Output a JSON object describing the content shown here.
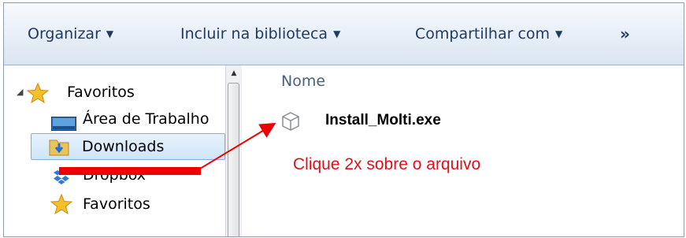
{
  "toolbar": {
    "organize_label": "Organizar",
    "library_label": "Incluir na biblioteca",
    "share_label": "Compartilhar com",
    "more_label": "»"
  },
  "nav": {
    "items": [
      {
        "label": "Favoritos",
        "icon": "star-icon"
      },
      {
        "label": "Área de Trabalho",
        "icon": "desktop-icon"
      },
      {
        "label": "Downloads",
        "icon": "downloads-folder-icon",
        "selected": true
      },
      {
        "label": "Dropbox",
        "icon": "dropbox-icon"
      },
      {
        "label": "Favoritos",
        "icon": "star-icon"
      }
    ]
  },
  "content": {
    "column_header": "Nome",
    "files": [
      {
        "name": "Install_Molti.exe",
        "icon": "exe-file-icon"
      }
    ]
  },
  "annotation": {
    "text": "Clique 2x sobre o arquivo",
    "color": "#e0101a"
  },
  "colors": {
    "toolbar_text": "#1e3a5f",
    "selection_border": "#84acdd",
    "annotation_red": "#ee0000"
  }
}
